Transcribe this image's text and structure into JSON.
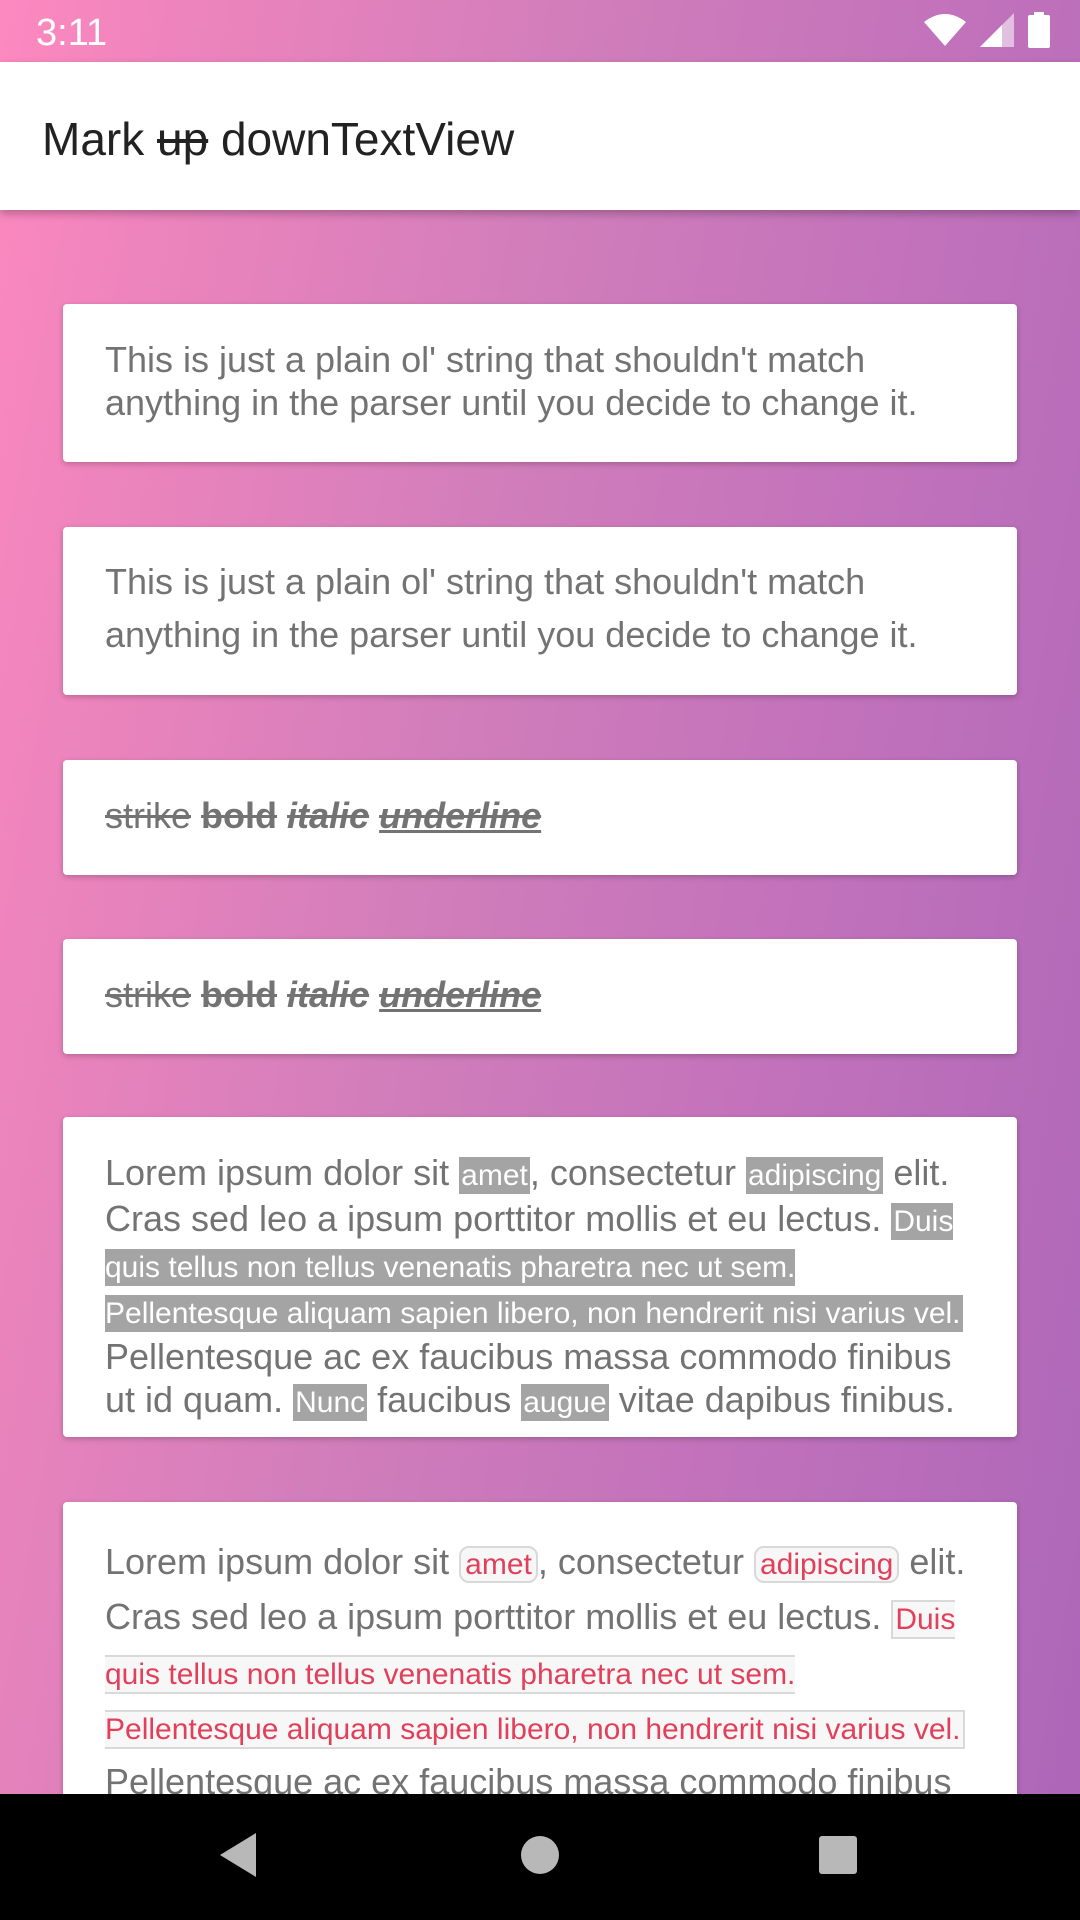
{
  "status_bar": {
    "time": "3:11"
  },
  "app_bar": {
    "title_before": "Mark ",
    "title_strike": "up",
    "title_after": " downTextView"
  },
  "cards": {
    "plain1": "This is just a plain ol' string that shouldn't match anything in the parser until you decide to change it.",
    "plain2": "This is just a plain ol' string that shouldn't match anything in the parser until you decide to change it.",
    "style1": {
      "strike": "strike",
      "bold": "bold",
      "italic": "italic",
      "underline": "underline"
    },
    "style2": {
      "strike": "strike",
      "bold": "bold",
      "italic": "italic",
      "underline": "underline"
    },
    "lorem_hl": {
      "t1": "Lorem ipsum dolor sit ",
      "h1": "amet",
      "t2": ", consectetur ",
      "h2": "adipiscing",
      "t3": " elit. Cras sed leo a ipsum porttitor mollis et eu lectus. ",
      "h3": "Duis quis tellus non tellus venenatis pharetra nec ut sem. Pellentesque aliquam sapien libero, non hendrerit nisi varius vel.",
      "t4": " Pellentesque ac ex faucibus massa commodo finibus ut id quam. ",
      "h4": "Nunc",
      "t5": " faucibus ",
      "h5": "augue",
      "t6": " vitae dapibus finibus."
    },
    "lorem_code": {
      "t1": "Lorem ipsum dolor sit ",
      "c1": "amet",
      "t2": ", consectetur ",
      "c2": "adipiscing",
      "t3": " elit. Cras sed leo a ipsum porttitor mollis et eu lectus. ",
      "c3": "Duis quis tellus non tellus venenatis pharetra nec ut sem. Pellentesque aliquam sapien libero, non hendrerit nisi varius vel.",
      "t4": " Pellentesque ac ex faucibus massa commodo finibus ut id"
    }
  },
  "nav_bar": {
    "back_icon": "back-triangle-icon",
    "home_icon": "home-circle-icon",
    "recents_icon": "recents-square-icon"
  },
  "colors": {
    "gradient_start": "#fd89c0",
    "gradient_end": "#ac66b8",
    "code_text": "#e2405a",
    "highlight_bg": "#a4a4a4"
  }
}
